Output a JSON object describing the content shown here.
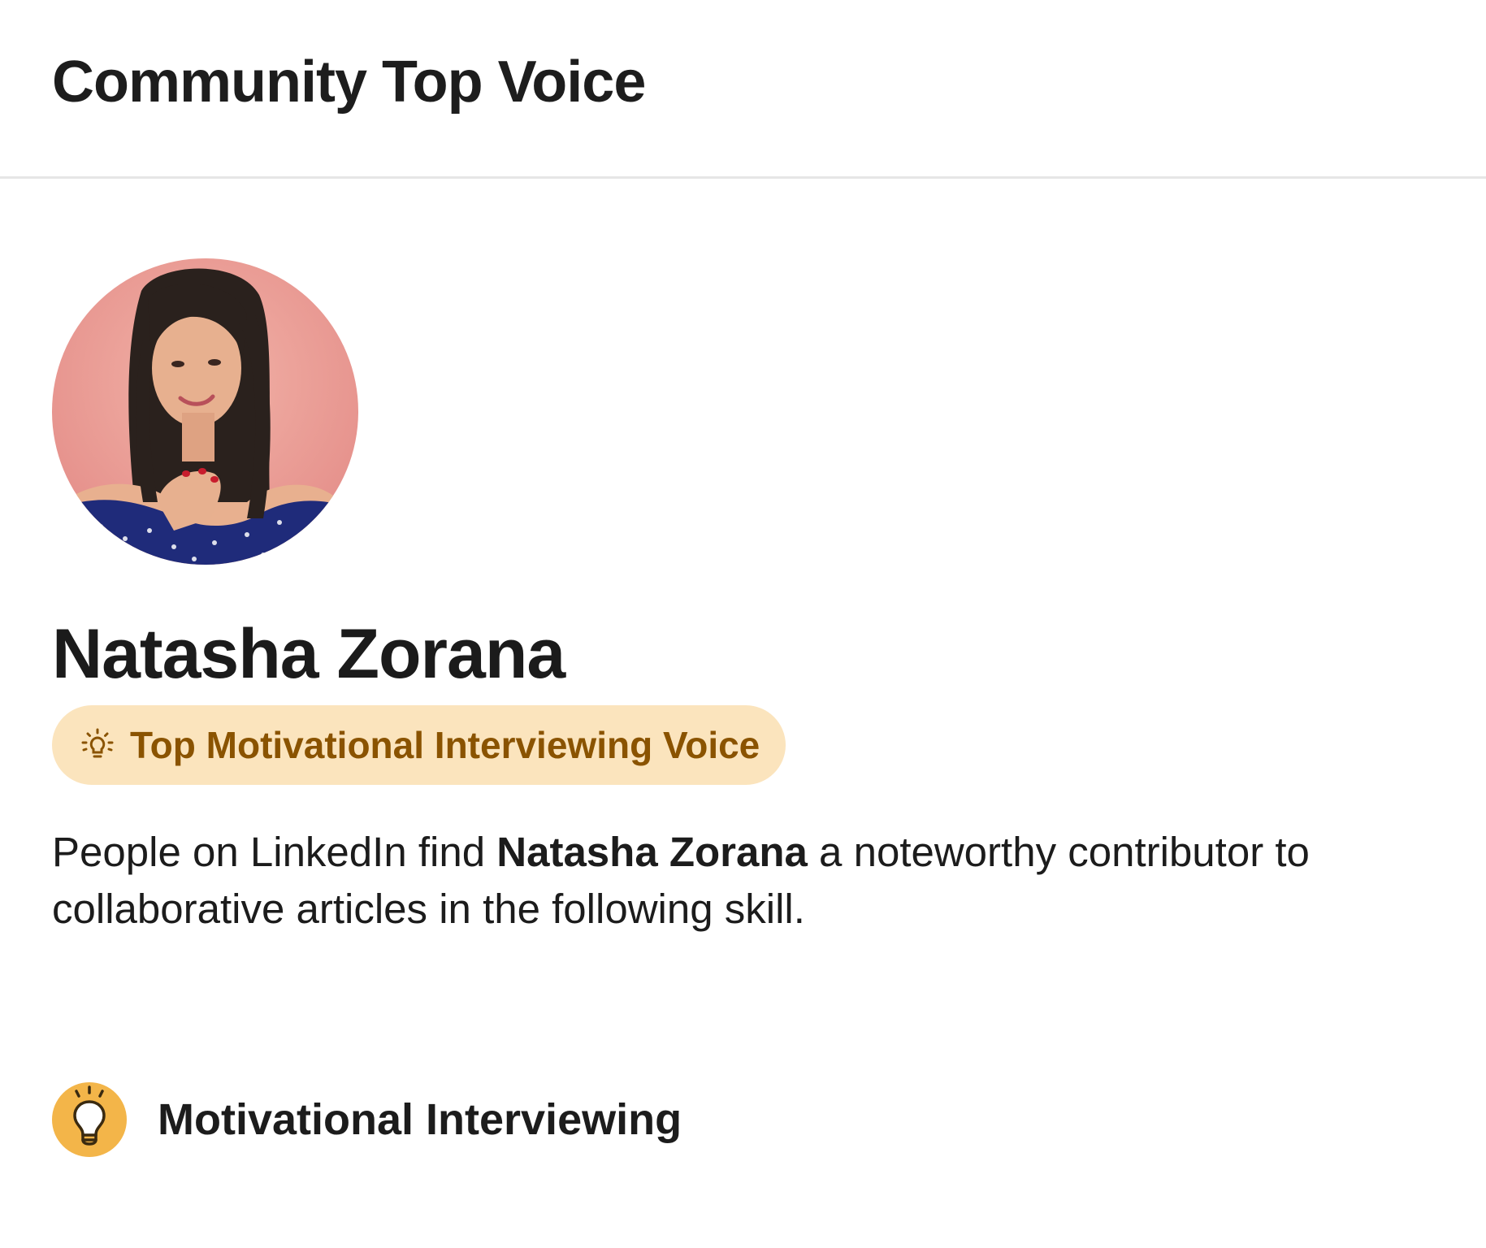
{
  "header": {
    "title": "Community Top Voice"
  },
  "profile": {
    "avatar_alt": "Natasha Zorana profile photo",
    "name": "Natasha Zorana"
  },
  "badge": {
    "icon": "lightbulb-icon",
    "label": "Top Motivational Interviewing Voice",
    "background_color": "#fbe4bd",
    "text_color": "#8a5300"
  },
  "description": {
    "prefix": "People on LinkedIn find ",
    "name_bold": "Natasha Zorana",
    "suffix": " a noteworthy contributor to collaborative articles in the following skill."
  },
  "skills": [
    {
      "icon": "lightbulb-icon",
      "icon_color": "#f3b549",
      "label": "Motivational Interviewing"
    }
  ]
}
